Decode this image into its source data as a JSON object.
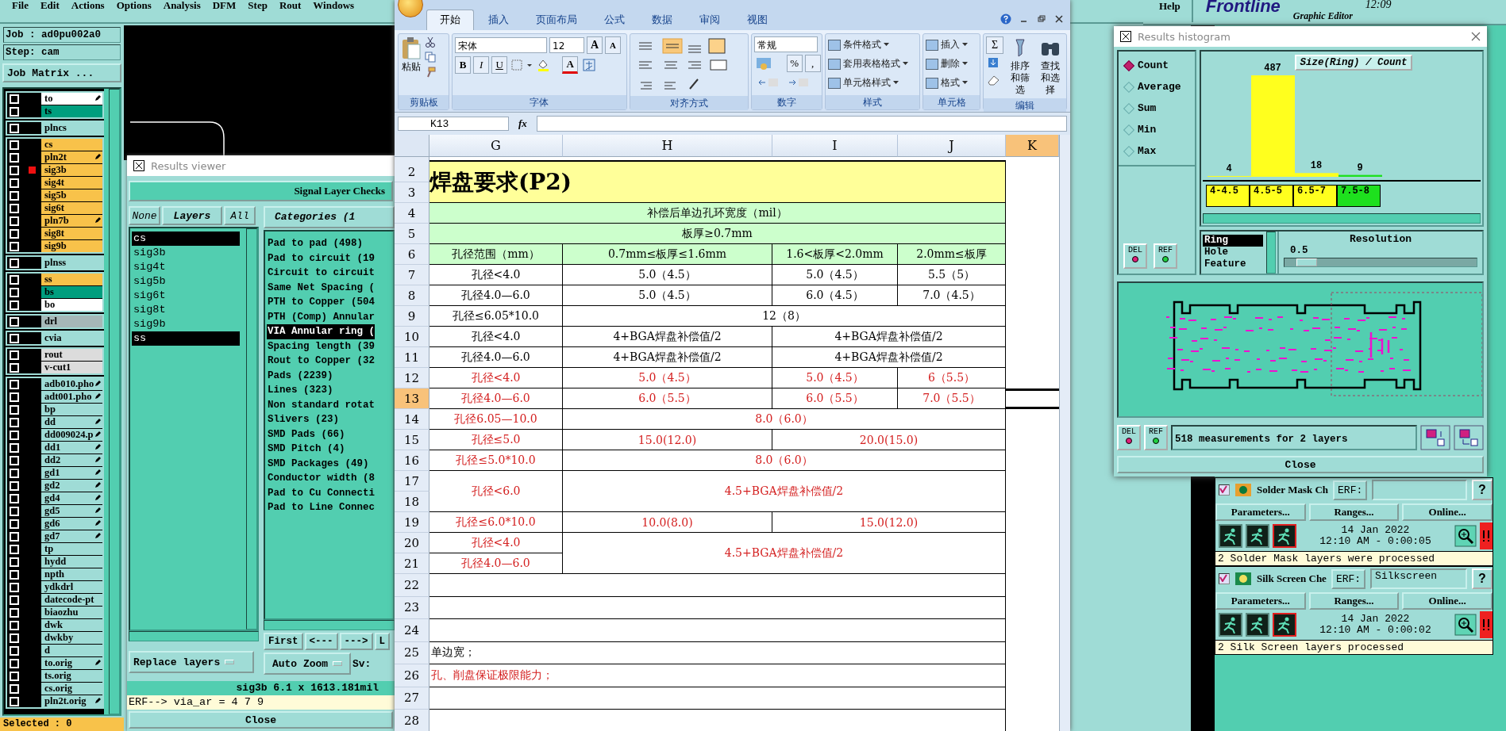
{
  "menu": {
    "items": [
      "File",
      "Edit",
      "Actions",
      "Options",
      "Analysis",
      "DFM",
      "Step",
      "Rout",
      "Windows"
    ],
    "help": "Help"
  },
  "header": {
    "logo": "Frontline",
    "subtitle": "Graphic Editor",
    "time": "12:09"
  },
  "job": {
    "job": "Job : ad0pu002a0",
    "step": "Step: cam",
    "matrix_button": "Job Matrix ..."
  },
  "layer_groups": [
    [
      {
        "name": "to",
        "color": "#ffffff",
        "tagged": true,
        "selected": false
      },
      {
        "name": "ts",
        "color": "#009e7e",
        "tagged": false,
        "selected": false
      }
    ],
    [
      {
        "name": "plncs",
        "color": "#9fdcd6",
        "tagged": false,
        "selected": false
      }
    ],
    [
      {
        "name": "cs",
        "color": "#f8c24a",
        "tagged": false,
        "selected": false
      },
      {
        "name": "pln2t",
        "color": "#f8c24a",
        "tagged": true,
        "selected": false
      },
      {
        "name": "sig3b",
        "color": "#f8c24a",
        "tagged": false,
        "selected": true
      },
      {
        "name": "sig4t",
        "color": "#f8c24a",
        "tagged": false,
        "selected": false
      },
      {
        "name": "sig5b",
        "color": "#f8c24a",
        "tagged": false,
        "selected": false
      },
      {
        "name": "sig6t",
        "color": "#f8c24a",
        "tagged": false,
        "selected": false
      },
      {
        "name": "pln7b",
        "color": "#f8c24a",
        "tagged": true,
        "selected": false
      },
      {
        "name": "sig8t",
        "color": "#f8c24a",
        "tagged": false,
        "selected": false
      },
      {
        "name": "sig9b",
        "color": "#f8c24a",
        "tagged": false,
        "selected": false
      }
    ],
    [
      {
        "name": "plnss",
        "color": "#9fdcd6",
        "tagged": false,
        "selected": false
      }
    ],
    [
      {
        "name": "ss",
        "color": "#f8c24a",
        "tagged": false,
        "selected": false
      },
      {
        "name": "bs",
        "color": "#009e7e",
        "tagged": false,
        "selected": false
      },
      {
        "name": "bo",
        "color": "#ffffff",
        "tagged": false,
        "selected": false
      }
    ],
    [
      {
        "name": "drl",
        "color": "#a6b8b8",
        "tagged": false,
        "selected": false
      }
    ],
    [
      {
        "name": "cvia",
        "color": "#9fdcd6",
        "tagged": false,
        "selected": false
      }
    ],
    [
      {
        "name": "rout",
        "color": "#dcdcdc",
        "tagged": false,
        "selected": false
      },
      {
        "name": "v-cut1",
        "color": "#dcdcdc",
        "tagged": false,
        "selected": false
      }
    ],
    [
      {
        "name": "adb010.pho",
        "color": "#9fdcd6",
        "tagged": true,
        "selected": false
      },
      {
        "name": "adt001.pho",
        "color": "#9fdcd6",
        "tagged": true,
        "selected": false
      },
      {
        "name": "bp",
        "color": "#9fdcd6",
        "tagged": false,
        "selected": false
      },
      {
        "name": "dd",
        "color": "#9fdcd6",
        "tagged": true,
        "selected": false
      },
      {
        "name": "dd009024.p",
        "color": "#9fdcd6",
        "tagged": true,
        "selected": false
      },
      {
        "name": "dd1",
        "color": "#9fdcd6",
        "tagged": true,
        "selected": false
      },
      {
        "name": "dd2",
        "color": "#9fdcd6",
        "tagged": true,
        "selected": false
      },
      {
        "name": "gd1",
        "color": "#9fdcd6",
        "tagged": true,
        "selected": false
      },
      {
        "name": "gd2",
        "color": "#9fdcd6",
        "tagged": true,
        "selected": false
      },
      {
        "name": "gd4",
        "color": "#9fdcd6",
        "tagged": true,
        "selected": false
      },
      {
        "name": "gd5",
        "color": "#9fdcd6",
        "tagged": true,
        "selected": false
      },
      {
        "name": "gd6",
        "color": "#9fdcd6",
        "tagged": true,
        "selected": false
      },
      {
        "name": "gd7",
        "color": "#9fdcd6",
        "tagged": true,
        "selected": false
      },
      {
        "name": "tp",
        "color": "#9fdcd6",
        "tagged": false,
        "selected": false
      },
      {
        "name": "hydd",
        "color": "#9fdcd6",
        "tagged": false,
        "selected": false
      },
      {
        "name": "npth",
        "color": "#9fdcd6",
        "tagged": false,
        "selected": false
      },
      {
        "name": "ydkdrl",
        "color": "#9fdcd6",
        "tagged": false,
        "selected": false
      },
      {
        "name": "datecode-pt",
        "color": "#9fdcd6",
        "tagged": false,
        "selected": false
      },
      {
        "name": "biaozhu",
        "color": "#9fdcd6",
        "tagged": false,
        "selected": false
      },
      {
        "name": "dwk",
        "color": "#9fdcd6",
        "tagged": false,
        "selected": false
      },
      {
        "name": "dwkby",
        "color": "#9fdcd6",
        "tagged": false,
        "selected": false
      },
      {
        "name": "d",
        "color": "#9fdcd6",
        "tagged": false,
        "selected": false
      },
      {
        "name": "to.orig",
        "color": "#9fdcd6",
        "tagged": true,
        "selected": false
      },
      {
        "name": "ts.orig",
        "color": "#9fdcd6",
        "tagged": false,
        "selected": false
      },
      {
        "name": "cs.orig",
        "color": "#9fdcd6",
        "tagged": false,
        "selected": false
      },
      {
        "name": "pln2t.orig",
        "color": "#9fdcd6",
        "tagged": true,
        "selected": false
      }
    ]
  ],
  "selected_status": "Selected : 0",
  "results_viewer": {
    "title": "Results viewer",
    "section": "Signal Layer Checks",
    "layer_buttons": [
      "None",
      "Layers",
      "All"
    ],
    "layers": [
      {
        "name": "cs",
        "selected": true
      },
      {
        "name": "sig3b",
        "selected": false
      },
      {
        "name": "sig4t",
        "selected": false
      },
      {
        "name": "sig5b",
        "selected": false
      },
      {
        "name": "sig6t",
        "selected": false
      },
      {
        "name": "sig8t",
        "selected": false
      },
      {
        "name": "sig9b",
        "selected": false
      },
      {
        "name": "ss",
        "selected": true
      }
    ],
    "categories_header": "Categories (1",
    "categories": [
      {
        "name": "Pad to pad (498)",
        "selected": false
      },
      {
        "name": "Pad to circuit (19",
        "selected": false
      },
      {
        "name": "Circuit to circuit",
        "selected": false
      },
      {
        "name": "Same Net Spacing (",
        "selected": false
      },
      {
        "name": "PTH to Copper (504",
        "selected": false
      },
      {
        "name": "PTH (Comp) Annular",
        "selected": false
      },
      {
        "name": "VIA Annular ring (",
        "selected": true
      },
      {
        "name": "Spacing length (39",
        "selected": false
      },
      {
        "name": "Rout to Copper (32",
        "selected": false
      },
      {
        "name": "Pads (2239)",
        "selected": false
      },
      {
        "name": "Lines (323)",
        "selected": false
      },
      {
        "name": "Non standard rotat",
        "selected": false
      },
      {
        "name": "Slivers (23)",
        "selected": false
      },
      {
        "name": "SMD Pads (66)",
        "selected": false
      },
      {
        "name": "SMD Pitch (4)",
        "selected": false
      },
      {
        "name": "SMD Packages (49)",
        "selected": false
      },
      {
        "name": "Conductor width (8",
        "selected": false
      },
      {
        "name": "Pad to Cu Connecti",
        "selected": false
      },
      {
        "name": "Pad to Line Connec",
        "selected": false
      }
    ],
    "nav_buttons": [
      "First",
      "<---",
      "--->",
      "L"
    ],
    "zoom_mode": "Auto Zoom",
    "sv_label": "Sv:",
    "replace_button": "Replace layers",
    "status": "sig3b 6.1 x 1613.181mil",
    "erf": "ERF--> via_ar = 4 7 9",
    "close": "Close"
  },
  "excel": {
    "tabs": [
      {
        "label": "开始",
        "selected": true
      },
      {
        "label": "插入",
        "selected": false
      },
      {
        "label": "页面布局",
        "selected": false
      },
      {
        "label": "公式",
        "selected": false
      },
      {
        "label": "数据",
        "selected": false
      },
      {
        "label": "审阅",
        "selected": false
      },
      {
        "label": "视图",
        "selected": false
      }
    ],
    "clipboard": {
      "paste": "粘贴",
      "label": "剪贴板"
    },
    "font": {
      "name": "宋体",
      "size": "12",
      "grow": "A",
      "shrink": "A",
      "bold": "B",
      "italic": "I",
      "underline": "U",
      "color_letter": "A",
      "label": "字体"
    },
    "alignment": {
      "label": "对齐方式"
    },
    "number": {
      "format": "常规",
      "percent": "%",
      "comma": ",",
      "label": "数字"
    },
    "styles": {
      "items": [
        "条件格式",
        "套用表格格式",
        "单元格样式"
      ],
      "label": "样式"
    },
    "cells": {
      "items": [
        "插入",
        "删除",
        "格式"
      ],
      "label": "单元格"
    },
    "editing": {
      "sum": "Σ",
      "sort": "排序和筛选",
      "find": "查找和选择",
      "label": "编辑"
    },
    "name_box": "K13",
    "fx": "fx",
    "columns": [
      {
        "label": "G",
        "selected": false
      },
      {
        "label": "H",
        "selected": false
      },
      {
        "label": "I",
        "selected": false
      },
      {
        "label": "J",
        "selected": false
      },
      {
        "label": "K",
        "selected": true
      }
    ],
    "rows": [
      {
        "row_labels": [
          "2",
          "3"
        ],
        "kind": "title",
        "selected": false,
        "cells": [
          {
            "text": "焊盘要求(P2)",
            "color": "#000000"
          }
        ]
      },
      {
        "row_labels": [
          "4"
        ],
        "kind": "header",
        "selected": false,
        "cells": [
          {
            "text": "补偿后单边孔环宽度（mil）",
            "color": "#000000"
          }
        ]
      },
      {
        "row_labels": [
          "5"
        ],
        "kind": "header",
        "selected": false,
        "cells": [
          {
            "text": "板厚≥0.7mm",
            "color": "#000000"
          }
        ]
      },
      {
        "row_labels": [
          "6"
        ],
        "kind": "header",
        "selected": false,
        "cells": [
          {
            "text": "孔径范围（mm）",
            "color": "#000000"
          },
          {
            "text": "0.7mm≤板厚≤1.6mm",
            "color": "#000000"
          },
          {
            "text": "1.6<板厚<2.0mm",
            "color": "#000000"
          },
          {
            "text": "2.0mm≤板厚",
            "color": "#000000"
          }
        ]
      },
      {
        "row_labels": [
          "7"
        ],
        "kind": "body",
        "selected": false,
        "cells": [
          {
            "text": "孔径<4.0",
            "color": "#000000"
          },
          {
            "text": "5.0（4.5）",
            "color": "#000000"
          },
          {
            "text": "5.0（4.5）",
            "color": "#000000"
          },
          {
            "text": "5.5（5）",
            "color": "#000000"
          }
        ]
      },
      {
        "row_labels": [
          "8"
        ],
        "kind": "body",
        "selected": false,
        "cells": [
          {
            "text": "孔径4.0—6.0",
            "color": "#000000"
          },
          {
            "text": "5.0（4.5）",
            "color": "#000000"
          },
          {
            "text": "6.0（4.5）",
            "color": "#000000"
          },
          {
            "text": "7.0（4.5）",
            "color": "#000000"
          }
        ]
      },
      {
        "row_labels": [
          "9"
        ],
        "kind": "body",
        "selected": false,
        "cells": [
          {
            "text": "孔径≤6.05*10.0",
            "color": "#000000"
          },
          {
            "text": "12（8）",
            "color": "#000000"
          }
        ]
      },
      {
        "row_labels": [
          "10"
        ],
        "kind": "body",
        "selected": false,
        "cells": [
          {
            "text": "孔径<4.0",
            "color": "#000000"
          },
          {
            "text": "4+BGA焊盘补偿值/2",
            "color": "#000000"
          },
          {
            "text": "4+BGA焊盘补偿值/2",
            "color": "#000000"
          }
        ]
      },
      {
        "row_labels": [
          "11"
        ],
        "kind": "body",
        "selected": false,
        "cells": [
          {
            "text": "孔径4.0—6.0",
            "color": "#000000"
          },
          {
            "text": "4+BGA焊盘补偿值/2",
            "color": "#000000"
          },
          {
            "text": "4+BGA焊盘补偿值/2",
            "color": "#000000"
          }
        ]
      },
      {
        "row_labels": [
          "12"
        ],
        "kind": "body",
        "selected": false,
        "cells": [
          {
            "text": "孔径<4.0",
            "color": "#d42020"
          },
          {
            "text": "5.0（4.5）",
            "color": "#d42020"
          },
          {
            "text": "5.0（4.5）",
            "color": "#d42020"
          },
          {
            "text": "6（5.5）",
            "color": "#d42020"
          }
        ]
      },
      {
        "row_labels": [
          "13"
        ],
        "kind": "body",
        "selected": true,
        "cells": [
          {
            "text": "孔径4.0—6.0",
            "color": "#d42020"
          },
          {
            "text": "6.0（5.5）",
            "color": "#d42020"
          },
          {
            "text": "6.0（5.5）",
            "color": "#d42020"
          },
          {
            "text": "7.0（5.5）",
            "color": "#d42020"
          }
        ]
      },
      {
        "row_labels": [
          "14"
        ],
        "kind": "body",
        "selected": false,
        "cells": [
          {
            "text": "孔径6.05—10.0",
            "color": "#d42020"
          },
          {
            "text": "8.0（6.0）",
            "color": "#d42020"
          }
        ]
      },
      {
        "row_labels": [
          "15"
        ],
        "kind": "body",
        "selected": false,
        "cells": [
          {
            "text": "孔径≤5.0",
            "color": "#d42020"
          },
          {
            "text": "15.0(12.0)",
            "color": "#d42020"
          },
          {
            "text": "20.0(15.0)",
            "color": "#d42020"
          }
        ]
      },
      {
        "row_labels": [
          "16"
        ],
        "kind": "body",
        "selected": false,
        "cells": [
          {
            "text": "孔径≤5.0*10.0",
            "color": "#d42020"
          },
          {
            "text": "8.0（6.0）",
            "color": "#d42020"
          }
        ]
      },
      {
        "row_labels": [
          "17",
          "18"
        ],
        "kind": "body",
        "selected": false,
        "cells": [
          {
            "text": "孔径<6.0",
            "color": "#d42020"
          },
          {
            "text": "4.5+BGA焊盘补偿值/2",
            "color": "#d42020"
          }
        ]
      },
      {
        "row_labels": [
          "19"
        ],
        "kind": "body",
        "selected": false,
        "cells": [
          {
            "text": "孔径≤6.0*10.0",
            "color": "#d42020"
          },
          {
            "text": "10.0(8.0)",
            "color": "#d42020"
          },
          {
            "text": "15.0(12.0)",
            "color": "#d42020"
          }
        ]
      },
      {
        "row_labels": [
          "20",
          "21"
        ],
        "kind": "body",
        "selected": false,
        "cells": [
          {
            "parts": [
              "孔径<4.0",
              "孔径4.0—6.0"
            ],
            "color": "#d42020"
          },
          {
            "text": "4.5+BGA焊盘补偿值/2",
            "color": "#d42020"
          }
        ]
      },
      {
        "row_labels": [
          "22"
        ],
        "kind": "blank",
        "selected": false
      },
      {
        "row_labels": [
          "23"
        ],
        "kind": "blank",
        "selected": false
      },
      {
        "row_labels": [
          "24"
        ],
        "kind": "blank",
        "selected": false
      },
      {
        "row_labels": [
          "25"
        ],
        "kind": "note",
        "selected": false,
        "cells": [
          {
            "text": "单边宽；",
            "color": "#000000"
          }
        ]
      },
      {
        "row_labels": [
          "26"
        ],
        "kind": "note",
        "selected": false,
        "cells": [
          {
            "text": "孔、削盘保证极限能力；",
            "color": "#d42020"
          }
        ]
      },
      {
        "row_labels": [
          "27"
        ],
        "kind": "blank",
        "selected": false
      },
      {
        "row_labels": [
          "28"
        ],
        "kind": "blank",
        "selected": false
      }
    ]
  },
  "histogram": {
    "title": "Results histogram",
    "modes": [
      {
        "label": "Count",
        "selected": true
      },
      {
        "label": "Average",
        "selected": false
      },
      {
        "label": "Sum",
        "selected": false
      },
      {
        "label": "Min",
        "selected": false
      },
      {
        "label": "Max",
        "selected": false
      }
    ],
    "chart_data": {
      "type": "bar",
      "title": "Size(Ring) / Count",
      "categories": [
        "4-4.5",
        "4.5-5",
        "6.5-7",
        "7.5-8"
      ],
      "values": [
        4,
        487,
        18,
        9
      ],
      "data_labels": true
    },
    "bins": [
      {
        "color": "#ffff1e"
      },
      {
        "color": "#ffff1e"
      },
      {
        "color": "#ffff1e"
      },
      {
        "color": "#1ee01e"
      }
    ],
    "measures": [
      {
        "label": "Ring",
        "selected": true
      },
      {
        "label": "Hole",
        "selected": false
      },
      {
        "label": "Feature",
        "selected": false
      }
    ],
    "resolution_label": "Resolution",
    "resolution_value": "0.5",
    "resolution": {
      "level": 0.06
    },
    "side_buttons": [
      "DEL",
      "REF"
    ],
    "bottom_buttons": [
      "DEL",
      "REF"
    ],
    "summary": "518 measurements for 2 layers",
    "close": "Close"
  },
  "checks": [
    {
      "name": "Solder Mask Ch",
      "checked": true,
      "erf_label": "ERF:",
      "help": "?",
      "buttons": [
        "Parameters...",
        "Ranges...",
        "Online..."
      ],
      "date": "14 Jan 2022",
      "time": "12:10 AM - 0:00:05",
      "message": "2 Solder Mask layers were processed"
    },
    {
      "name": "Silk Screen Che",
      "checked": true,
      "erf_label": "ERF:",
      "erf_value": "Silkscreen",
      "help": "?",
      "buttons": [
        "Parameters...",
        "Ranges...",
        "Online..."
      ],
      "date": "14 Jan 2022",
      "time": "12:10 AM - 0:00:02",
      "message": "2 Silk Screen layers processed"
    }
  ]
}
